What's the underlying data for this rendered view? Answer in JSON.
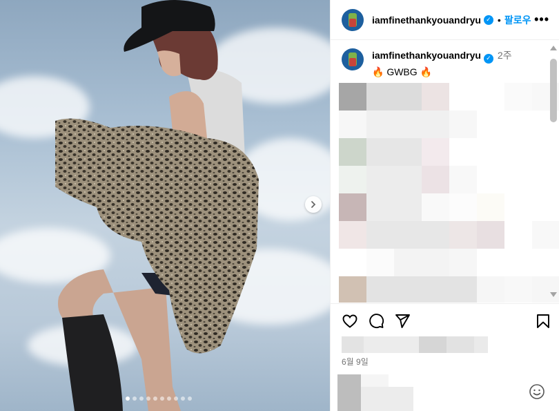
{
  "post": {
    "username": "iamfinethankyouandryu",
    "follow_label": "팔로우",
    "separator": "•",
    "more_label": "•••",
    "caption": {
      "username": "iamfinethankyouandryu",
      "time_ago": "2주",
      "text": "🔥 GWBG 🔥"
    },
    "date": "6월 9일"
  },
  "carousel": {
    "total_slides": 10,
    "active_index": 0
  },
  "icons": {
    "like": "heart-icon",
    "comment": "comment-icon",
    "share": "send-icon",
    "save": "bookmark-icon",
    "emoji": "emoji-icon",
    "next": "chevron-right-icon",
    "verified": "verified-badge-icon",
    "more": "more-options-icon"
  },
  "colors": {
    "accent": "#0095f6",
    "secondary_text": "#737373",
    "border": "#efefef"
  }
}
